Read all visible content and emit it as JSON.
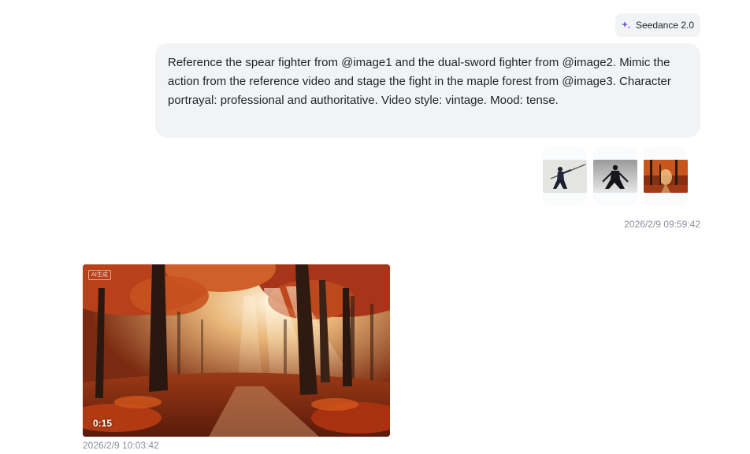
{
  "model_tag": {
    "label": "Seedance 2.0",
    "icon": "sparkle-icon",
    "accent": "#6b4fd8"
  },
  "user_message": {
    "text": "Reference the spear fighter from @image1 and the dual-sword fighter from @image2. Mimic the action from the reference video and stage the fight in the maple forest from @image3. Character portrayal: professional and authoritative. Video style: vintage. Mood: tense.",
    "attachments": [
      {
        "name": "image1",
        "subject": "spear fighter"
      },
      {
        "name": "image2",
        "subject": "dual-sword fighter"
      },
      {
        "name": "image3",
        "subject": "maple forest"
      }
    ],
    "timestamp": "2026/2/9 09:59:42"
  },
  "response": {
    "video": {
      "duration": "0:15",
      "watermark": "AI生成"
    },
    "timestamp": "2026/2/9 10:03:42"
  }
}
